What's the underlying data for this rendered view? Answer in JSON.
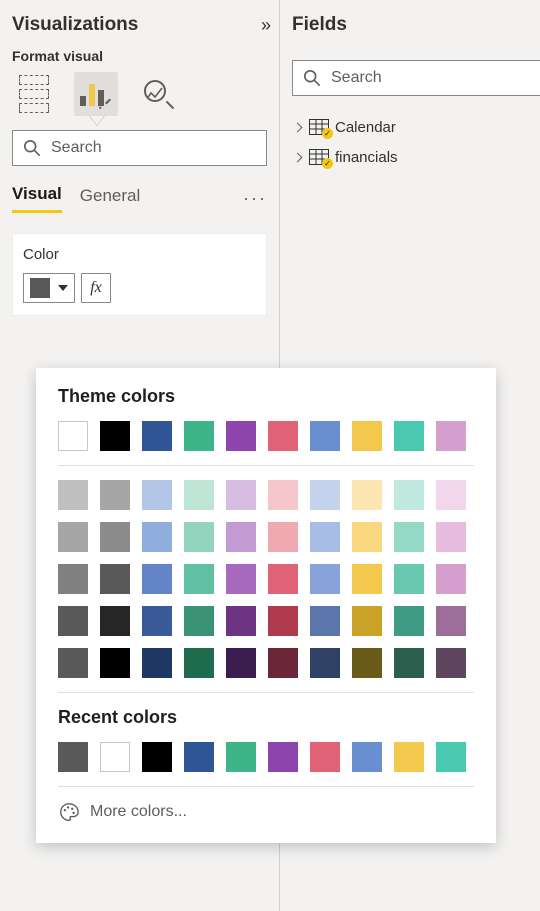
{
  "viz": {
    "title": "Visualizations",
    "subtitle": "Format visual",
    "search_placeholder": "Search",
    "tabs": {
      "visual": "Visual",
      "general": "General"
    },
    "color": {
      "label": "Color",
      "current": "#595959",
      "fx": "fx"
    }
  },
  "fields": {
    "title": "Fields",
    "search_placeholder": "Search",
    "tables": [
      {
        "name": "Calendar"
      },
      {
        "name": "financials"
      }
    ]
  },
  "popup": {
    "theme_heading": "Theme colors",
    "recent_heading": "Recent colors",
    "more_label": "More colors...",
    "theme_colors_row1": [
      "#FFFFFF",
      "#000000",
      "#2F5597",
      "#3EB489",
      "#8E44AD",
      "#E06377",
      "#6A8FD1",
      "#F2C94C",
      "#48C9B0",
      "#D49FCF"
    ],
    "theme_shades": [
      [
        "#BFBFBF",
        "#A6A6A6",
        "#B4C6E7",
        "#BEE4D6",
        "#D7BDE2",
        "#F5C6CB",
        "#C5D3EC",
        "#FCE6B1",
        "#BFE8DE",
        "#F2D7EC"
      ],
      [
        "#A6A6A6",
        "#8C8C8C",
        "#8FAEDE",
        "#93D4BE",
        "#C39BD3",
        "#F1A9B1",
        "#A7BDE4",
        "#F9D77E",
        "#94D8C6",
        "#E8BCDF"
      ],
      [
        "#808080",
        "#595959",
        "#6384C6",
        "#5FC0A4",
        "#A569BD",
        "#E06377",
        "#88A3D9",
        "#F2C94C",
        "#69C9B0",
        "#D49FCF"
      ],
      [
        "#595959",
        "#262626",
        "#3B5B98",
        "#3B9275",
        "#6C3483",
        "#B03A4E",
        "#5A76AB",
        "#C9A227",
        "#3F9B83",
        "#9E6E9A"
      ],
      [
        "#595959",
        "#000000",
        "#1F3864",
        "#1E6B4E",
        "#3B1E4F",
        "#6B2737",
        "#2F4266",
        "#6B5B1A",
        "#2A5E4D",
        "#5E475E"
      ]
    ],
    "recent_colors": [
      "#595959",
      "#FFFFFF",
      "#000000",
      "#2F5597",
      "#3EB489",
      "#8E44AD",
      "#E06377",
      "#6A8FD1",
      "#F2C94C",
      "#48C9B0"
    ]
  }
}
